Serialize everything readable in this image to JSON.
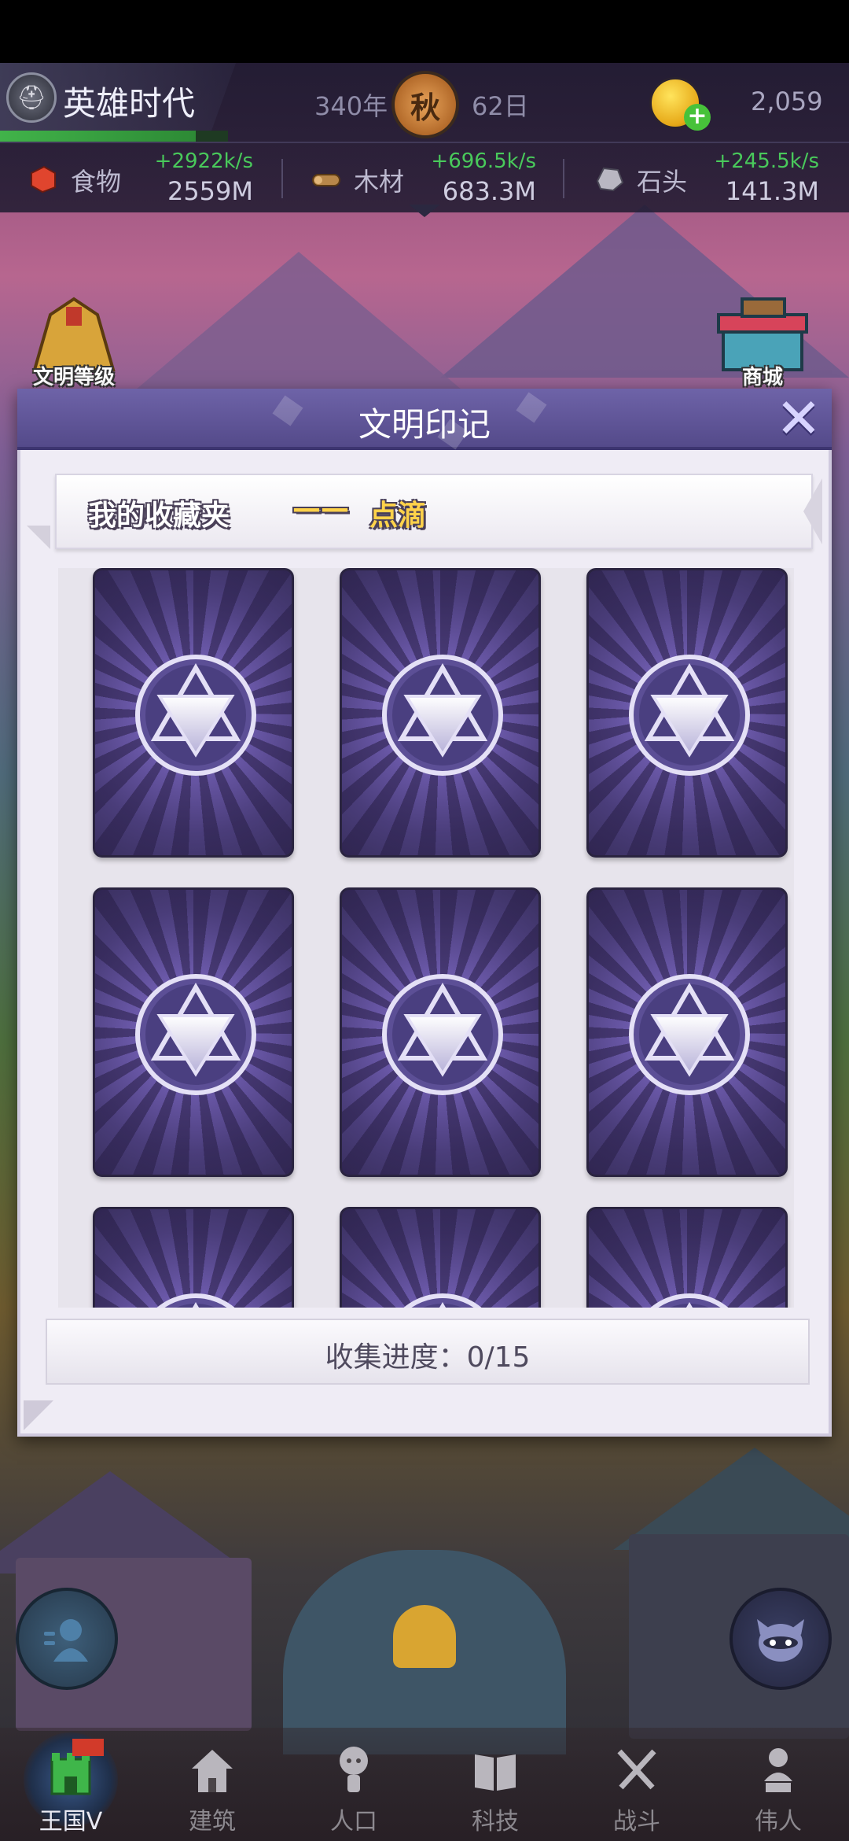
{
  "header": {
    "game_title": "英雄时代",
    "year": "340年",
    "season": "秋",
    "day": "62日",
    "coins": "2,059",
    "helmet_icon": "spartan-helmet-icon",
    "coin_icon": "gold-coin-icon",
    "exp_progress": 0.86
  },
  "resources": [
    {
      "name": "食物",
      "rate": "+2922k/s",
      "amount": "2559M",
      "icon": "food-icon",
      "color": "#e0452e"
    },
    {
      "name": "木材",
      "rate": "+696.5k/s",
      "amount": "683.3M",
      "icon": "wood-icon",
      "color": "#b8874a"
    },
    {
      "name": "石头",
      "rate": "+245.5k/s",
      "amount": "141.3M",
      "icon": "stone-icon",
      "color": "#b9b7c2"
    }
  ],
  "side_buttons": {
    "left_label": "文明等级",
    "right_label": "商城"
  },
  "modal": {
    "title": "文明印记",
    "ribbon_label": "我的收藏夹",
    "ribbon_dash": "——",
    "ribbon_name": "点滴",
    "progress": "收集进度：0/15",
    "card_count_total": 15,
    "cards_visible": 9
  },
  "nav": [
    {
      "label": "王国V",
      "icon": "castle-icon",
      "active": true
    },
    {
      "label": "建筑",
      "icon": "house-icon",
      "active": false
    },
    {
      "label": "人口",
      "icon": "person-icon",
      "active": false
    },
    {
      "label": "科技",
      "icon": "book-icon",
      "active": false
    },
    {
      "label": "战斗",
      "icon": "crossed-swords-icon",
      "active": false
    },
    {
      "label": "伟人",
      "icon": "bust-icon",
      "active": false
    }
  ],
  "colors": {
    "accent_purple": "#5c519a",
    "rate_green": "#49c95b",
    "ribbon_gold": "#ffd24a"
  }
}
